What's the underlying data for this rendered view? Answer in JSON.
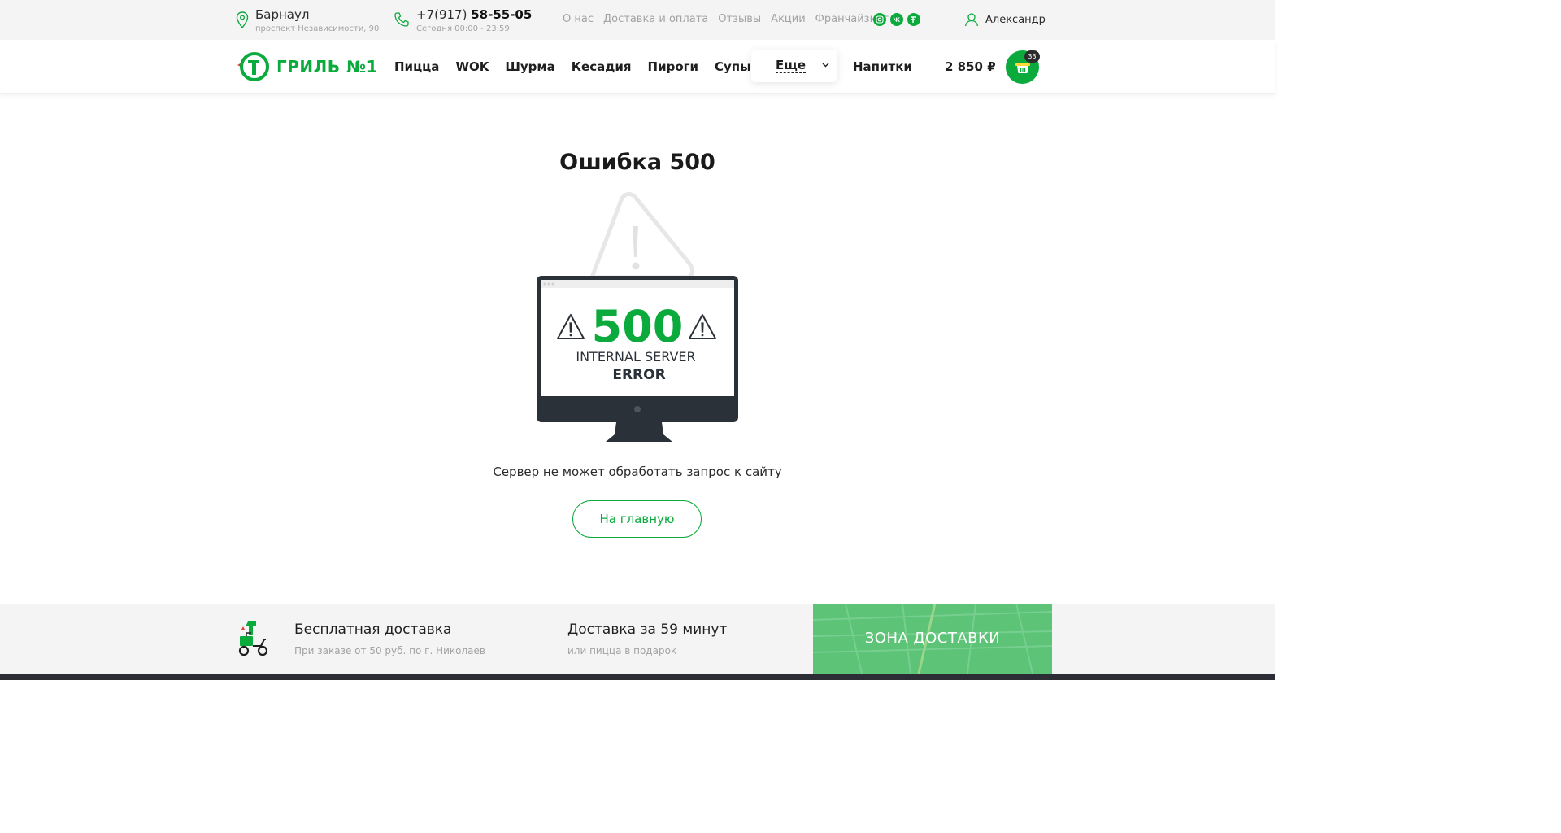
{
  "topbar": {
    "city": "Барнаул",
    "address": "проспект Независимости, 90",
    "phone_prefix": "+7(917)",
    "phone_main": "58-55-05",
    "hours": "Сегодня 00:00 - 23:59",
    "links": [
      "О нас",
      "Доставка и оплата",
      "Отзывы",
      "Акции",
      "Франчайзинг"
    ],
    "socials": [
      "instagram-icon",
      "vk-icon",
      "fl-icon"
    ],
    "user_name": "Александр"
  },
  "header": {
    "logo_text": "ГРИЛЬ №1",
    "nav": [
      "Пицца",
      "WOK",
      "Шурма",
      "Кесадия",
      "Пироги",
      "Супы"
    ],
    "more_label": "Еще",
    "drinks_label": "Напитки",
    "cart_total": "2 850 ₽",
    "cart_count": "33"
  },
  "main": {
    "title": "Ошибка 500",
    "error_code": "500",
    "error_line1": "INTERNAL SERVER",
    "error_line2": "ERROR",
    "description": "Сервер не может обработать запрос к сайту",
    "home_button": "На главную"
  },
  "footer_info": {
    "item1_title": "Бесплатная доставка",
    "item1_sub": "При заказе от 50 руб. по г. Николаев",
    "item2_title": "Доставка за 59 минут",
    "item2_sub": "или пицца в подарок",
    "zone_label": "ЗОНА ДОСТАВКИ"
  },
  "colors": {
    "accent": "#0aaa3c",
    "dark": "#2d2d35",
    "topbar_bg": "#f4f4f4"
  }
}
